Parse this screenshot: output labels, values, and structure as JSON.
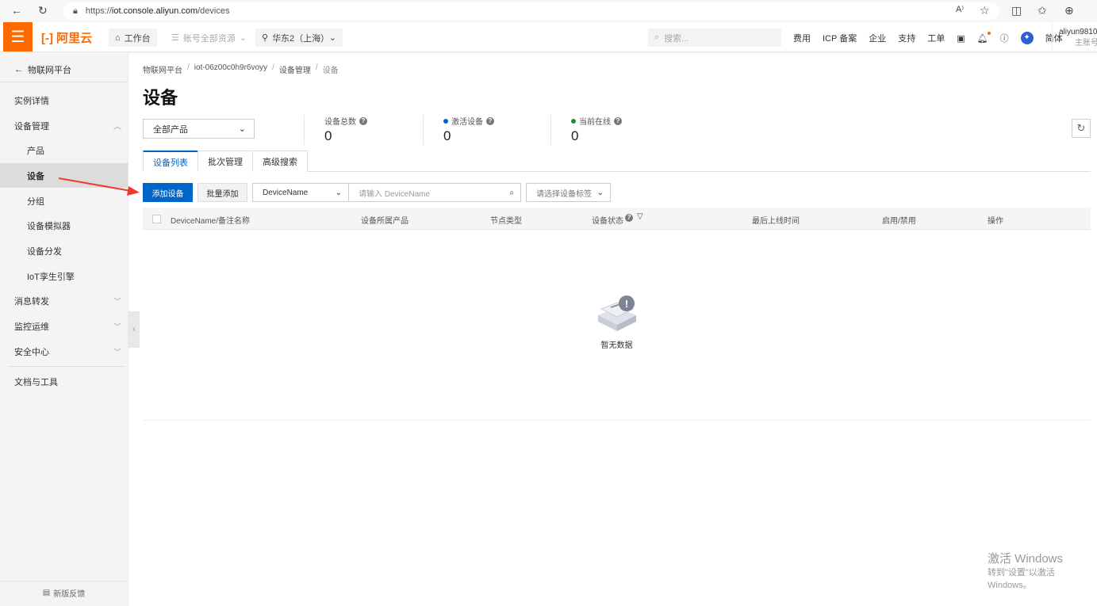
{
  "browser": {
    "url_prefix": "https://",
    "url_host": "iot.console.aliyun.com",
    "url_path": "/devices"
  },
  "topbar": {
    "logo": "阿里云",
    "workbench": "工作台",
    "resources": "账号全部资源",
    "region": "华东2（上海）",
    "search_placeholder": "搜索...",
    "links": [
      "费用",
      "ICP 备案",
      "企业",
      "支持",
      "工单"
    ],
    "lang": "简体",
    "user": "aliyun98108",
    "user_sub": "主账号"
  },
  "sidebar": {
    "back": "物联网平台",
    "items": [
      {
        "label": "实例详情"
      },
      {
        "label": "设备管理"
      },
      {
        "label": "产品"
      },
      {
        "label": "设备"
      },
      {
        "label": "分组"
      },
      {
        "label": "设备模拟器"
      },
      {
        "label": "设备分发"
      },
      {
        "label": "IoT孪生引擎"
      },
      {
        "label": "消息转发"
      },
      {
        "label": "监控运维"
      },
      {
        "label": "安全中心"
      },
      {
        "label": "文档与工具"
      }
    ],
    "feedback": "新版反馈"
  },
  "breadcrumb": [
    "物联网平台",
    "iot-06z00c0h9r6voyy",
    "设备管理",
    "设备"
  ],
  "page_title": "设备",
  "product_select": "全部产品",
  "stats": [
    {
      "label": "设备总数",
      "value": "0"
    },
    {
      "label": "激活设备",
      "value": "0",
      "color": "#0064c8"
    },
    {
      "label": "当前在线",
      "value": "0",
      "color": "#1e8e3e"
    }
  ],
  "tabs": [
    "设备列表",
    "批次管理",
    "高级搜索"
  ],
  "toolbar": {
    "add": "添加设备",
    "batch_add": "批量添加",
    "field_select": "DeviceName",
    "search_placeholder": "请输入 DeviceName",
    "tag_select": "请选择设备标签"
  },
  "table": {
    "columns": [
      "DeviceName/备注名称",
      "设备所属产品",
      "节点类型",
      "设备状态",
      "最后上线时间",
      "启用/禁用",
      "操作"
    ],
    "empty": "暂无数据"
  },
  "watermark": {
    "title": "激活 Windows",
    "sub": "转到\"设置\"以激活 Windows。"
  }
}
